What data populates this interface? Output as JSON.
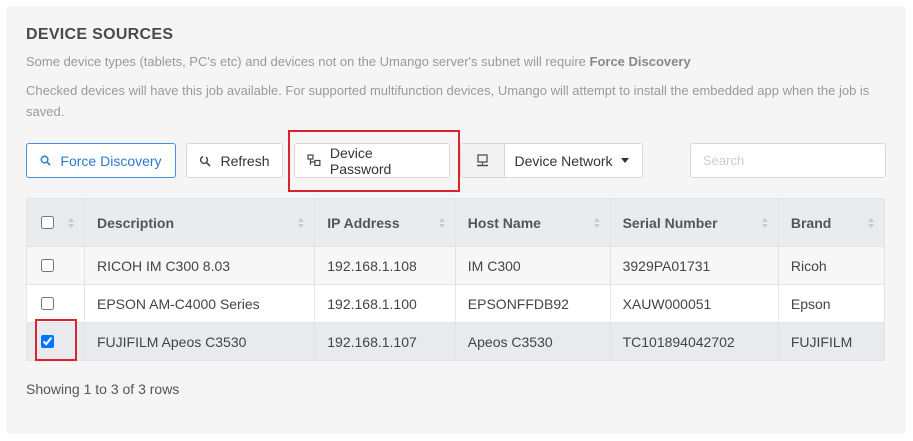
{
  "section": {
    "title": "DEVICE SOURCES",
    "note1_prefix": "Some device types (tablets, PC's etc) and devices not on the Umango server's subnet will require ",
    "note1_bold": "Force Discovery",
    "note2": "Checked devices will have this job available. For supported multifunction devices, Umango will attempt to install the embedded app when the job is saved."
  },
  "toolbar": {
    "force_discovery_label": "Force Discovery",
    "refresh_label": "Refresh",
    "device_password_label": "Device Password",
    "device_network_label": "Device Network"
  },
  "search": {
    "placeholder": "Search",
    "value": ""
  },
  "table": {
    "columns": [
      "Description",
      "IP Address",
      "Host Name",
      "Serial Number",
      "Brand"
    ],
    "rows": [
      {
        "checked": false,
        "description": "RICOH IM C300 8.03",
        "ip": "192.168.1.108",
        "host": "IM C300",
        "serial": "3929PA01731",
        "brand": "Ricoh"
      },
      {
        "checked": false,
        "description": "EPSON AM-C4000 Series",
        "ip": "192.168.1.100",
        "host": "EPSONFFDB92",
        "serial": "XAUW000051",
        "brand": "Epson"
      },
      {
        "checked": true,
        "description": "FUJIFILM Apeos C3530",
        "ip": "192.168.1.107",
        "host": "Apeos C3530",
        "serial": "TC101894042702",
        "brand": "FUJIFILM"
      }
    ]
  },
  "footer": {
    "text": "Showing 1 to 3 of 3 rows"
  },
  "colors": {
    "accent": "#2a7acc",
    "highlight_box": "#d9232e",
    "panel_bg": "#f5f5f5"
  }
}
